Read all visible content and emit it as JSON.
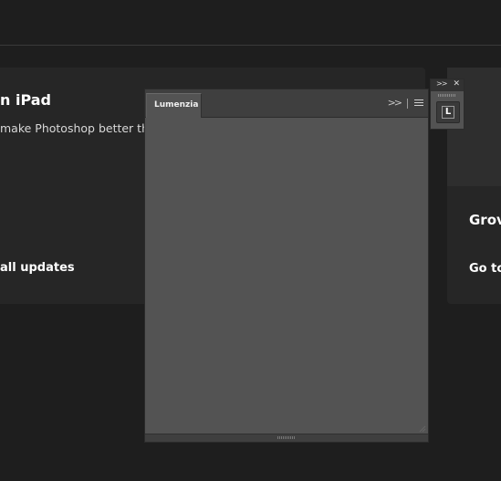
{
  "background_cards": {
    "left": {
      "title": "n iPad",
      "description": "make Photoshop better than",
      "link": "all updates"
    },
    "right": {
      "title": "Grov",
      "link": "Go to"
    }
  },
  "panel": {
    "tab_label": "Lumenzia",
    "collapse_icon": "double-chevron-right-icon",
    "menu_icon": "hamburger-menu-icon"
  },
  "mini_panel": {
    "expand_icon": "double-chevron-right-icon",
    "close_icon": "close-icon",
    "button_letter": "L"
  },
  "colors": {
    "app_background": "#1e1e1e",
    "card_background": "#262626",
    "panel_background": "#535353",
    "panel_header": "#3f3f3f"
  }
}
